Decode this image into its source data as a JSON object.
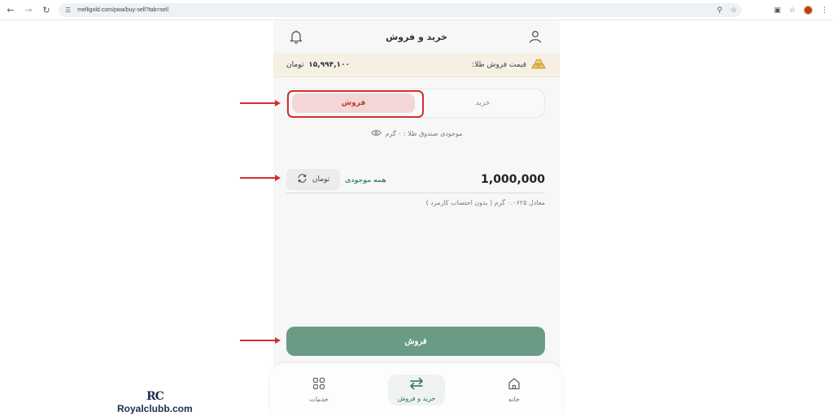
{
  "browser": {
    "url": "melligold.com/pwa/buy-sell?tab=sell"
  },
  "header": {
    "title": "خرید و فروش"
  },
  "price": {
    "label": "قیمت فروش طلا:",
    "value": "۱۵,۹۹۴,۱۰۰",
    "unit": "تومان"
  },
  "tabs": {
    "buy": "خرید",
    "sell": "فروش",
    "active": "sell"
  },
  "balance": {
    "text": "موجودی صندوق طلا : ۰ گرم"
  },
  "amount": {
    "value": "1,000,000",
    "unit": "تومان",
    "all_balance": "همه موجودی",
    "equivalent": "معادل ۰.۰۶۲۵ گرم ( بدون احتساب کارمزد )"
  },
  "action": {
    "sell_label": "فروش"
  },
  "bottom_nav": {
    "items": [
      {
        "label": "خانه",
        "icon": "home-icon"
      },
      {
        "label": "خرید و فروش",
        "icon": "swap-arrows-icon",
        "active": true
      },
      {
        "label": "خدمات",
        "icon": "grid-icon"
      }
    ]
  },
  "watermark": {
    "logo": "RC",
    "text": "Royalclubb.com"
  },
  "colors": {
    "accent_green": "#6a9b85",
    "sell_red": "#c0392b",
    "annotation_red": "#d32f2f",
    "price_bar_bg": "#f5efe4"
  }
}
